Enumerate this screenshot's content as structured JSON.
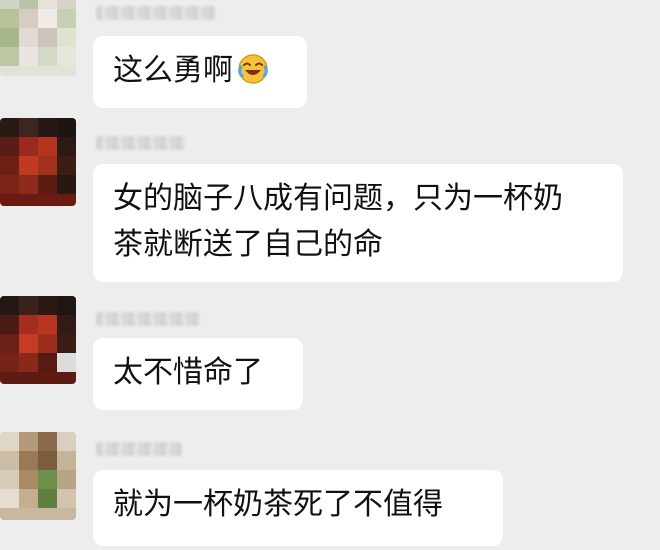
{
  "messages": [
    {
      "sender_name": "",
      "text": "这么勇啊",
      "emoji": "laughing-crying-emoji"
    },
    {
      "sender_name": "",
      "text_line1": "女的脑子八成有问题，只为一杯奶",
      "text_line2": "茶就断送了自己的命"
    },
    {
      "sender_name": "",
      "text": "太不惜命了"
    },
    {
      "sender_name": "",
      "text": "就为一杯奶茶死了不值得"
    }
  ],
  "colors": {
    "background": "#ededed",
    "bubble": "#ffffff",
    "text": "#111111"
  }
}
